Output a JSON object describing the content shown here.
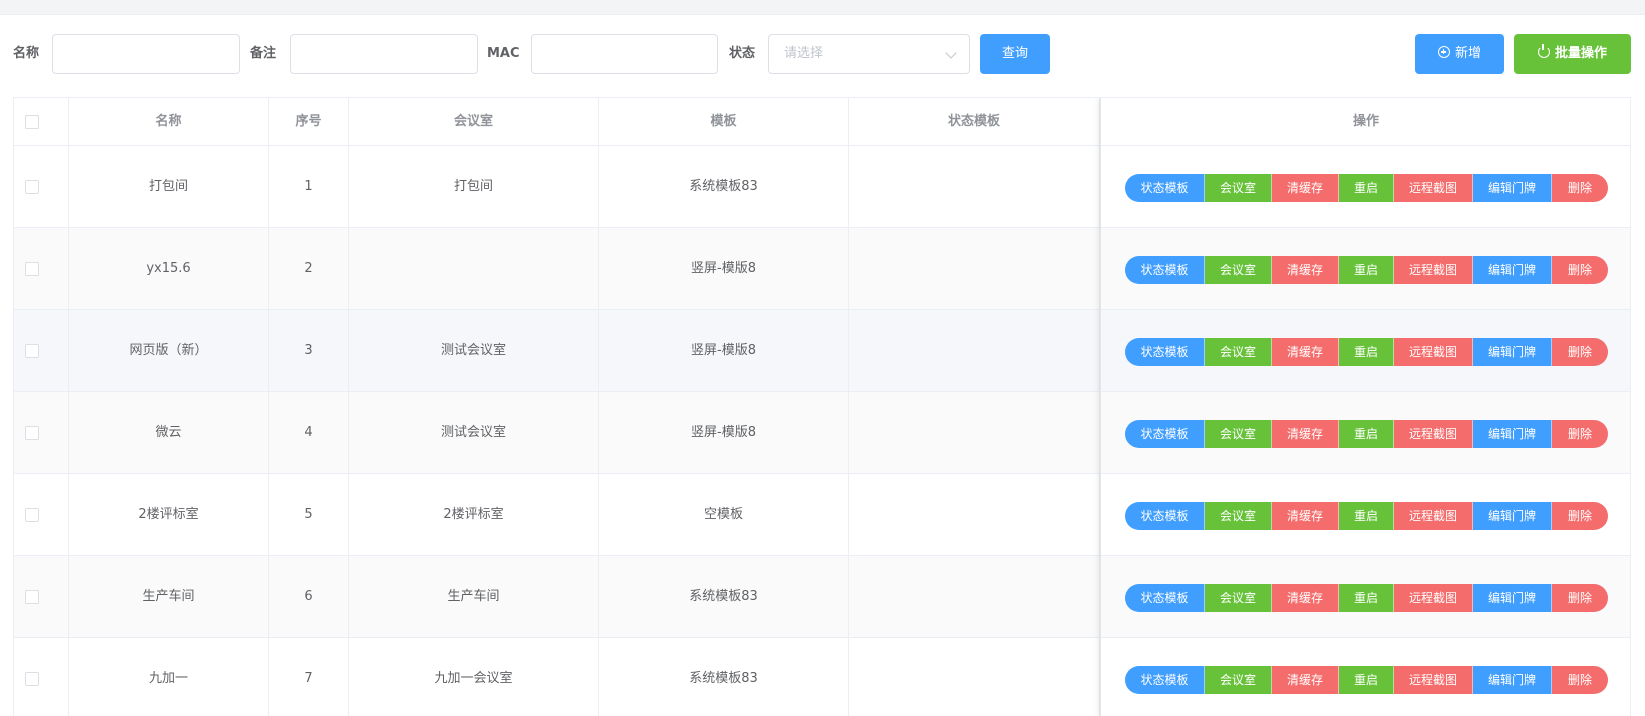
{
  "filters": {
    "name_label": "名称",
    "remark_label": "备注",
    "mac_label": "MAC",
    "status_label": "状态",
    "status_placeholder": "请选择",
    "query_label": "查询",
    "add_label": "新增",
    "batch_label": "批量操作"
  },
  "table": {
    "headers": {
      "name": "名称",
      "seq": "序号",
      "room": "会议室",
      "template": "模板",
      "status_template": "状态模板",
      "ops": "操作"
    },
    "actions": [
      "状态模板",
      "会议室",
      "清缓存",
      "重启",
      "远程截图",
      "编辑门牌",
      "删除"
    ],
    "rows": [
      {
        "name": "打包间",
        "seq": "1",
        "room": "打包间",
        "template": "系统模板83",
        "status_template": ""
      },
      {
        "name": "yx15.6",
        "seq": "2",
        "room": "",
        "template": "竖屏-模版8",
        "status_template": ""
      },
      {
        "name": "网页版（新）",
        "seq": "3",
        "room": "测试会议室",
        "template": "竖屏-模版8",
        "status_template": ""
      },
      {
        "name": "微云",
        "seq": "4",
        "room": "测试会议室",
        "template": "竖屏-模版8",
        "status_template": ""
      },
      {
        "name": "2楼评标室",
        "seq": "5",
        "room": "2楼评标室",
        "template": "空模板",
        "status_template": ""
      },
      {
        "name": "生产车间",
        "seq": "6",
        "room": "生产车间",
        "template": "系统模板83",
        "status_template": ""
      },
      {
        "name": "九加一",
        "seq": "7",
        "room": "九加一会议室",
        "template": "系统模板83",
        "status_template": ""
      }
    ]
  },
  "colors": {
    "primary": "#409eff",
    "success": "#67c23a",
    "danger": "#f56c6c"
  }
}
